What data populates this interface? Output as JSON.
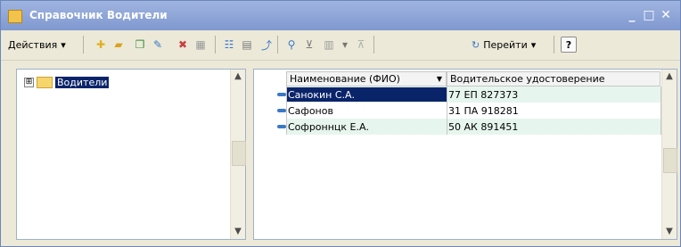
{
  "window": {
    "title": "Справочник Водители"
  },
  "toolbar": {
    "actions_label": "Действия",
    "goto_label": "Перейти",
    "help_label": "?"
  },
  "tree": {
    "root_label": "Водители",
    "expand_symbol": "⊞"
  },
  "grid": {
    "columns": [
      "Наименование (ФИО)",
      "Водительское удостоверение"
    ],
    "rows": [
      {
        "name": "Санокин С.А.",
        "license": "77 ЕП 827373"
      },
      {
        "name": "Сафонов",
        "license": "31 ПА 918281"
      },
      {
        "name": "Софроннцк Е.А.",
        "license": "50 АК 891451"
      }
    ]
  }
}
